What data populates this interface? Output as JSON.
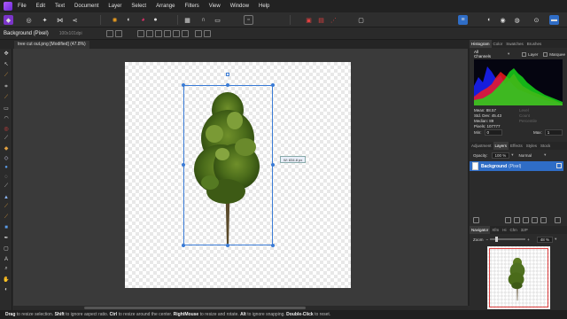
{
  "menu": [
    "File",
    "Edit",
    "Text",
    "Document",
    "Layer",
    "Select",
    "Arrange",
    "Filters",
    "View",
    "Window",
    "Help"
  ],
  "context": {
    "layer_name": "Background (Pixel)",
    "dimensions": "100x101dpi"
  },
  "document": {
    "tab_title": "tree cut out.png [Modified] (47.8%)",
    "size_tooltip": "W: 834.8 px"
  },
  "right_panel": {
    "tabs": [
      "Histogram",
      "Color",
      "Swatches",
      "Brushes"
    ],
    "channel": "All Channels",
    "layer_check_label": "Layer",
    "marquee_check_label": "Marquee",
    "stats": {
      "mean": "Mean: 88.57",
      "std_dev": "Std. Dev: 45.43",
      "median": "Median: 89",
      "pixels": "Pixels: 107777"
    },
    "stats_right": [
      "Level",
      "Count",
      "Percentile"
    ],
    "min_label": "Min:",
    "min_value": "0",
    "max_label": "Max:",
    "max_value": "1",
    "layer_tabs": [
      "Adjustment",
      "Layers",
      "Effects",
      "Styles",
      "Stock"
    ],
    "opacity_label": "Opacity:",
    "opacity_value": "100 %",
    "blend_mode": "Normal",
    "layer": {
      "name": "Background",
      "type": "(Pixel)"
    },
    "nav_tabs": [
      "Navigator",
      "Xfm",
      "Hi",
      "Chn",
      "32P"
    ],
    "zoom_label": "Zoom",
    "zoom_value": "48 %"
  },
  "status": {
    "drag": "Drag",
    "t1": " to resize selection. ",
    "shift": "Shift",
    "t2": " to ignore aspect ratio. ",
    "ctrl": "Ctrl",
    "t3": " to resize around the center. ",
    "rmb": "RightMouse",
    "t4": " to resize and rotate. ",
    "alt": "Alt",
    "t5": " to ignore snapping. ",
    "dbl": "Double-Click",
    "t6": " to reset."
  },
  "colors": {
    "accent": "#3a7bd5",
    "layer_selected": "#2f6dc6",
    "app_brand": "#8e3fe6"
  }
}
